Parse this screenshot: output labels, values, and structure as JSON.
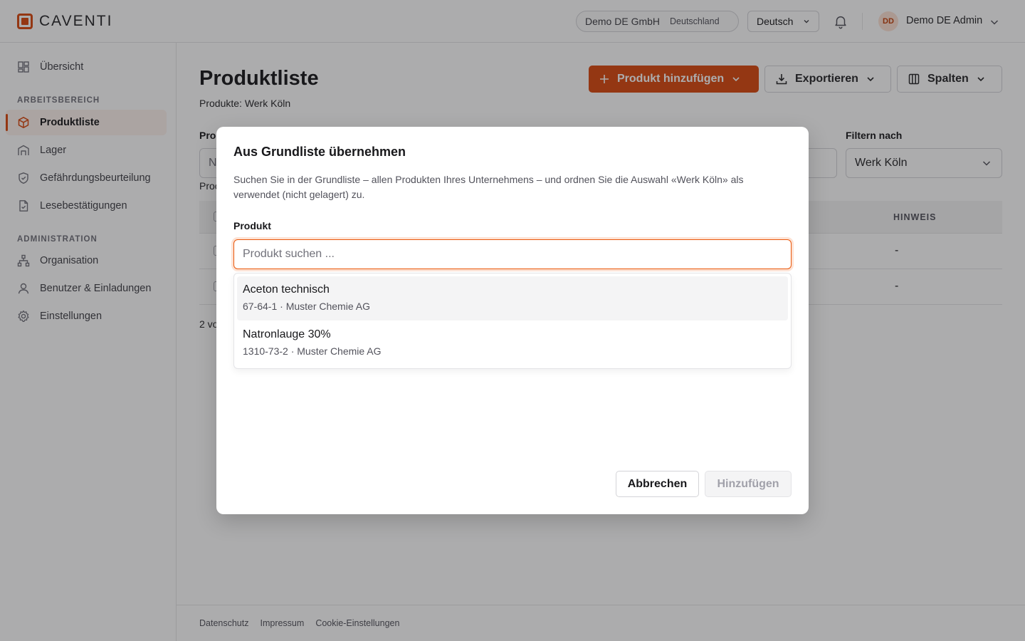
{
  "brand": {
    "name": "CAVENTI",
    "accent": "#d9480f"
  },
  "header": {
    "company": "Demo DE GmbH",
    "country": "Deutschland",
    "language": "Deutsch",
    "user_initials": "DD",
    "user_name": "Demo DE Admin"
  },
  "sidebar": {
    "overview": "Übersicht",
    "section_work": "ARBEITSBEREICH",
    "items_work": [
      {
        "label": "Produktliste",
        "icon": "box-icon",
        "active": true
      },
      {
        "label": "Lager",
        "icon": "warehouse-icon"
      },
      {
        "label": "Gefährdungsbeurteilung",
        "icon": "shield-icon"
      },
      {
        "label": "Lesebestätigungen",
        "icon": "document-check-icon"
      }
    ],
    "section_admin": "ADMINISTRATION",
    "items_admin": [
      {
        "label": "Organisation",
        "icon": "org-tree-icon"
      },
      {
        "label": "Benutzer & Einladungen",
        "icon": "user-icon"
      },
      {
        "label": "Einstellungen",
        "icon": "gear-icon"
      }
    ]
  },
  "main": {
    "title": "Produktliste",
    "subtitle": "Produkte: Werk Köln",
    "add_button": "Produkt hinzufügen",
    "export_button": "Exportieren",
    "columns_button": "Spalten",
    "search_label_partial": "Pro",
    "search_placeholder_partial": "N",
    "filter_label": "Filtern nach",
    "filter_value": "Werk Köln",
    "count_partial": "Proc",
    "table": {
      "hint_header": "HINWEIS",
      "rows": [
        {
          "hint": "-"
        },
        {
          "hint": "-"
        }
      ]
    },
    "pager_partial": "2 vo"
  },
  "footer": {
    "links": [
      "Datenschutz",
      "Impressum",
      "Cookie-Einstellungen"
    ]
  },
  "dialog": {
    "title": "Aus Grundliste übernehmen",
    "description": "Suchen Sie in der Grundliste – allen Produkten Ihres Unternehmens – und ordnen Sie die Auswahl «Werk Köln» als verwendet (nicht gelagert) zu.",
    "product_label": "Produkt",
    "search_placeholder": "Produkt suchen ...",
    "search_value": "",
    "options": [
      {
        "name": "Aceton technisch",
        "meta": "67-64-1 · Muster Chemie AG",
        "highlighted": true
      },
      {
        "name": "Natronlauge 30%",
        "meta": "1310-73-2 · Muster Chemie AG",
        "highlighted": false
      }
    ],
    "cancel_button": "Abbrechen",
    "add_button": "Hinzufügen"
  }
}
